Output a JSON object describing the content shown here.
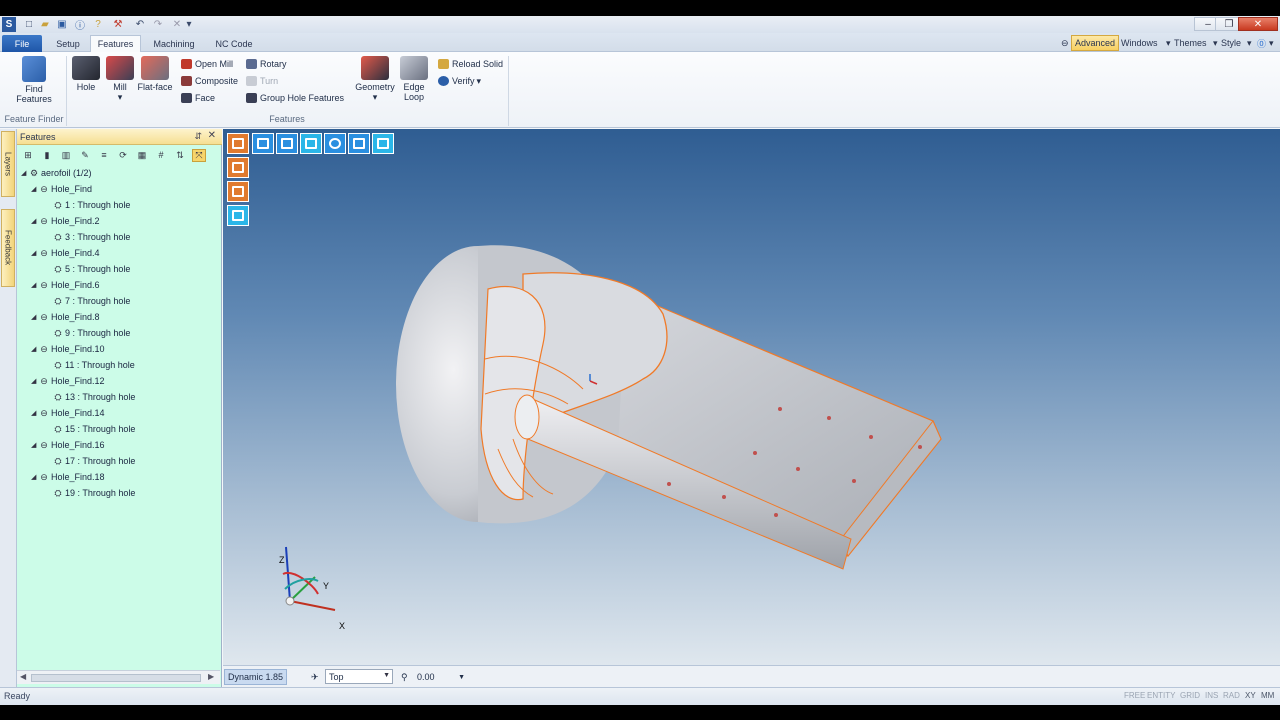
{
  "app": {
    "quick_access_icons": [
      "app-logo-icon",
      "new-icon",
      "open-icon",
      "save-icon",
      "info-icon",
      "help-icon",
      "tools-icon",
      "undo-icon",
      "redo-icon",
      "delete-icon",
      "customize-icon"
    ]
  },
  "ribbon": {
    "tabs": [
      {
        "label": "File"
      },
      {
        "label": "Setup"
      },
      {
        "label": "Features"
      },
      {
        "label": "Machining"
      },
      {
        "label": "NC Code"
      }
    ],
    "active_tab": "Features",
    "right": {
      "advanced": "Advanced",
      "windows": "Windows",
      "themes": "Themes",
      "style": "Style"
    },
    "feature_finder": {
      "find_features": "Find Features",
      "group_label": "Feature Finder"
    },
    "features": {
      "hole": "Hole",
      "mill": "Mill",
      "flat_face": "Flat-face",
      "open_mill": "Open Mill",
      "composite": "Composite",
      "face": "Face",
      "rotary": "Rotary",
      "turn": "Turn",
      "group_hole_features": "Group Hole Features",
      "geometry": "Geometry",
      "edge_loop_1": "Edge",
      "edge_loop_2": "Loop",
      "reload_solid": "Reload Solid",
      "verify": "Verify",
      "group_label": "Features"
    }
  },
  "side_tabs": {
    "layers": "Layers",
    "feedback": "Feedback"
  },
  "panel": {
    "title": "Features",
    "root": "aerofoil (1/2)",
    "groups": [
      {
        "name": "Hole_Find",
        "child": "1 : Through hole"
      },
      {
        "name": "Hole_Find.2",
        "child": "3 : Through hole"
      },
      {
        "name": "Hole_Find.4",
        "child": "5 : Through hole"
      },
      {
        "name": "Hole_Find.6",
        "child": "7 : Through hole"
      },
      {
        "name": "Hole_Find.8",
        "child": "9 : Through hole"
      },
      {
        "name": "Hole_Find.10",
        "child": "11 : Through hole"
      },
      {
        "name": "Hole_Find.12",
        "child": "13 : Through hole"
      },
      {
        "name": "Hole_Find.14",
        "child": "15 : Through hole"
      },
      {
        "name": "Hole_Find.16",
        "child": "17 : Through hole"
      },
      {
        "name": "Hole_Find.18",
        "child": "19 : Through hole"
      }
    ]
  },
  "viewport": {
    "triad": {
      "z": "Z",
      "y": "Y",
      "x": "X"
    },
    "colors": {
      "edge": "#f07a28",
      "toolbar_orange": "#e07a2e",
      "toolbar_blue": "#2a8fe0"
    }
  },
  "view_status": {
    "dynamic": "Dynamic 1.85",
    "view": "Top",
    "value": "0.00"
  },
  "status": {
    "left": "Ready",
    "indicators": [
      "FREE",
      "ENTITY",
      "GRID",
      "INS",
      "RAD",
      "XY",
      "MM"
    ]
  }
}
